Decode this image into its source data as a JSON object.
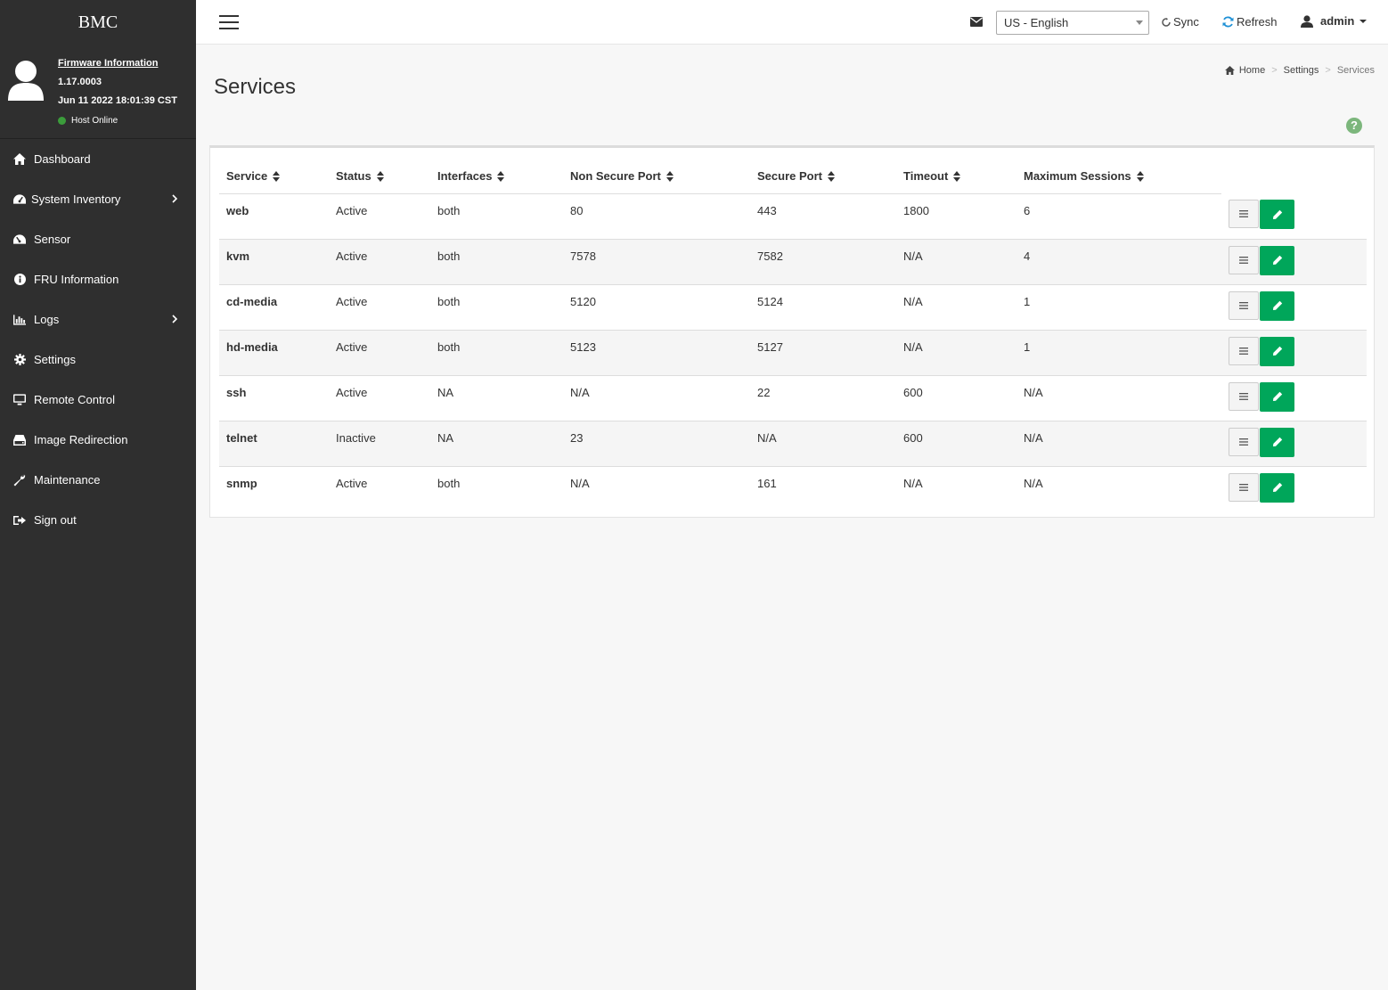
{
  "sidebar": {
    "brand": "BMC",
    "firmware_link": "Firmware Information",
    "firmware_version": "1.17.0003",
    "firmware_date": "Jun 11 2022 18:01:39 CST",
    "host_status": "Host Online",
    "host_status_color": "#3b9c3b",
    "items": [
      {
        "label": "Dashboard",
        "icon": "home-icon"
      },
      {
        "label": "System Inventory",
        "icon": "dashboard-gauge-icon",
        "expandable": true
      },
      {
        "label": "Sensor",
        "icon": "gauge-icon"
      },
      {
        "label": "FRU Information",
        "icon": "info-circle-icon"
      },
      {
        "label": "Logs",
        "icon": "bar-chart-icon",
        "expandable": true
      },
      {
        "label": "Settings",
        "icon": "gear-icon"
      },
      {
        "label": "Remote Control",
        "icon": "monitor-icon"
      },
      {
        "label": "Image Redirection",
        "icon": "hdd-icon"
      },
      {
        "label": "Maintenance",
        "icon": "wrench-icon"
      },
      {
        "label": "Sign out",
        "icon": "sign-out-icon"
      }
    ]
  },
  "topbar": {
    "language": "US - English",
    "sync_label": "Sync",
    "refresh_label": "Refresh",
    "user": "admin",
    "accent_color": "#1e90d6"
  },
  "page": {
    "title": "Services",
    "breadcrumb": [
      "Home",
      "Settings",
      "Services"
    ]
  },
  "table": {
    "columns": [
      "Service",
      "Status",
      "Interfaces",
      "Non Secure Port",
      "Secure Port",
      "Timeout",
      "Maximum Sessions"
    ],
    "rows": [
      [
        "web",
        "Active",
        "both",
        "80",
        "443",
        "1800",
        "6"
      ],
      [
        "kvm",
        "Active",
        "both",
        "7578",
        "7582",
        "N/A",
        "4"
      ],
      [
        "cd-media",
        "Active",
        "both",
        "5120",
        "5124",
        "N/A",
        "1"
      ],
      [
        "hd-media",
        "Active",
        "both",
        "5123",
        "5127",
        "N/A",
        "1"
      ],
      [
        "ssh",
        "Active",
        "NA",
        "N/A",
        "22",
        "600",
        "N/A"
      ],
      [
        "telnet",
        "Inactive",
        "NA",
        "23",
        "N/A",
        "600",
        "N/A"
      ],
      [
        "snmp",
        "Active",
        "both",
        "N/A",
        "161",
        "N/A",
        "N/A"
      ]
    ],
    "edit_button_color": "#00a65a"
  }
}
